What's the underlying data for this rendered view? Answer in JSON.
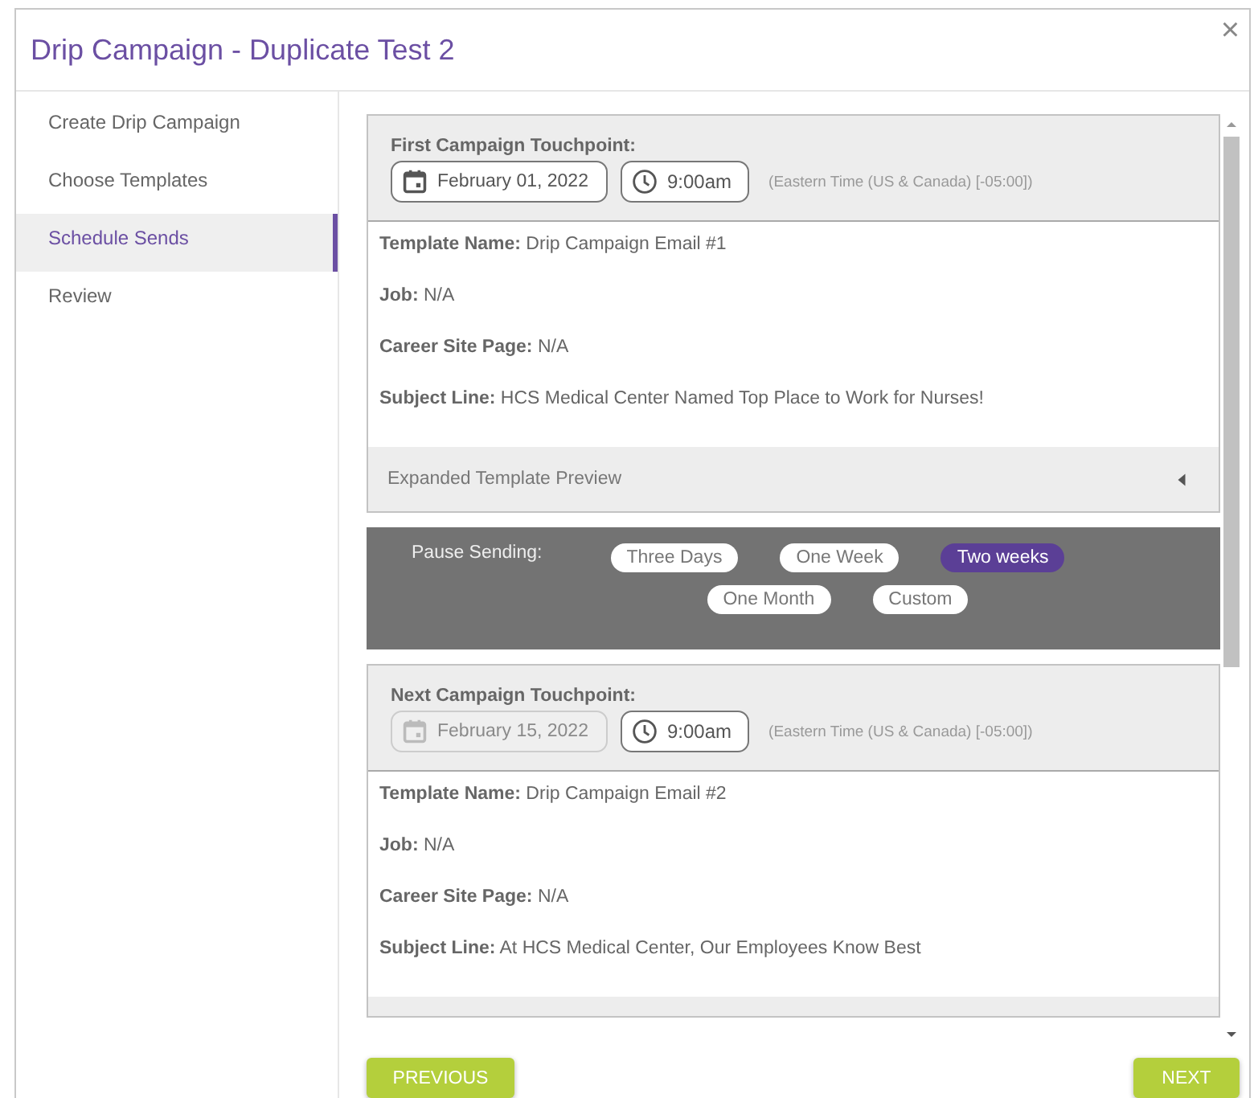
{
  "dialog": {
    "title": "Drip Campaign - Duplicate Test 2",
    "close": "×"
  },
  "sidebar": {
    "items": [
      {
        "label": "Create Drip Campaign",
        "selected": false
      },
      {
        "label": "Choose Templates",
        "selected": false
      },
      {
        "label": "Schedule Sends",
        "selected": true
      },
      {
        "label": "Review",
        "selected": false
      }
    ]
  },
  "touchpoints": [
    {
      "heading": "First Campaign Touchpoint:",
      "date": {
        "value": "February 01, 2022",
        "disabled": false
      },
      "time": "9:00am",
      "timezone": "(Eastern Time (US & Canada) [-05:00])",
      "fields": [
        {
          "label": "Template Name:",
          "value": "Drip Campaign Email #1"
        },
        {
          "label": "Job:",
          "value": "N/A"
        },
        {
          "label": "Career Site Page:",
          "value": "N/A"
        },
        {
          "label": "Subject Line:",
          "value": "HCS Medical Center Named Top Place to Work for Nurses!"
        }
      ],
      "preview": {
        "label": "Expanded Template Preview",
        "expanded": false
      },
      "pause": {
        "label": "Pause Sending:",
        "options": [
          {
            "label": "Three Days",
            "selected": false
          },
          {
            "label": "One Week",
            "selected": false
          },
          {
            "label": "Two weeks",
            "selected": true
          },
          {
            "label": "One Month",
            "selected": false
          },
          {
            "label": "Custom",
            "selected": false
          }
        ]
      }
    },
    {
      "heading": "Next Campaign Touchpoint:",
      "date": {
        "value": "February 15, 2022",
        "disabled": true
      },
      "time": "9:00am",
      "timezone": "(Eastern Time (US & Canada) [-05:00])",
      "fields": [
        {
          "label": "Template Name:",
          "value": "Drip Campaign Email #2"
        },
        {
          "label": "Job:",
          "value": "N/A"
        },
        {
          "label": "Career Site Page:",
          "value": "N/A"
        },
        {
          "label": "Subject Line:",
          "value": "At HCS Medical Center, Our Employees Know Best"
        }
      ]
    }
  ],
  "buttons": {
    "previous": "PREVIOUS",
    "next": "NEXT"
  }
}
